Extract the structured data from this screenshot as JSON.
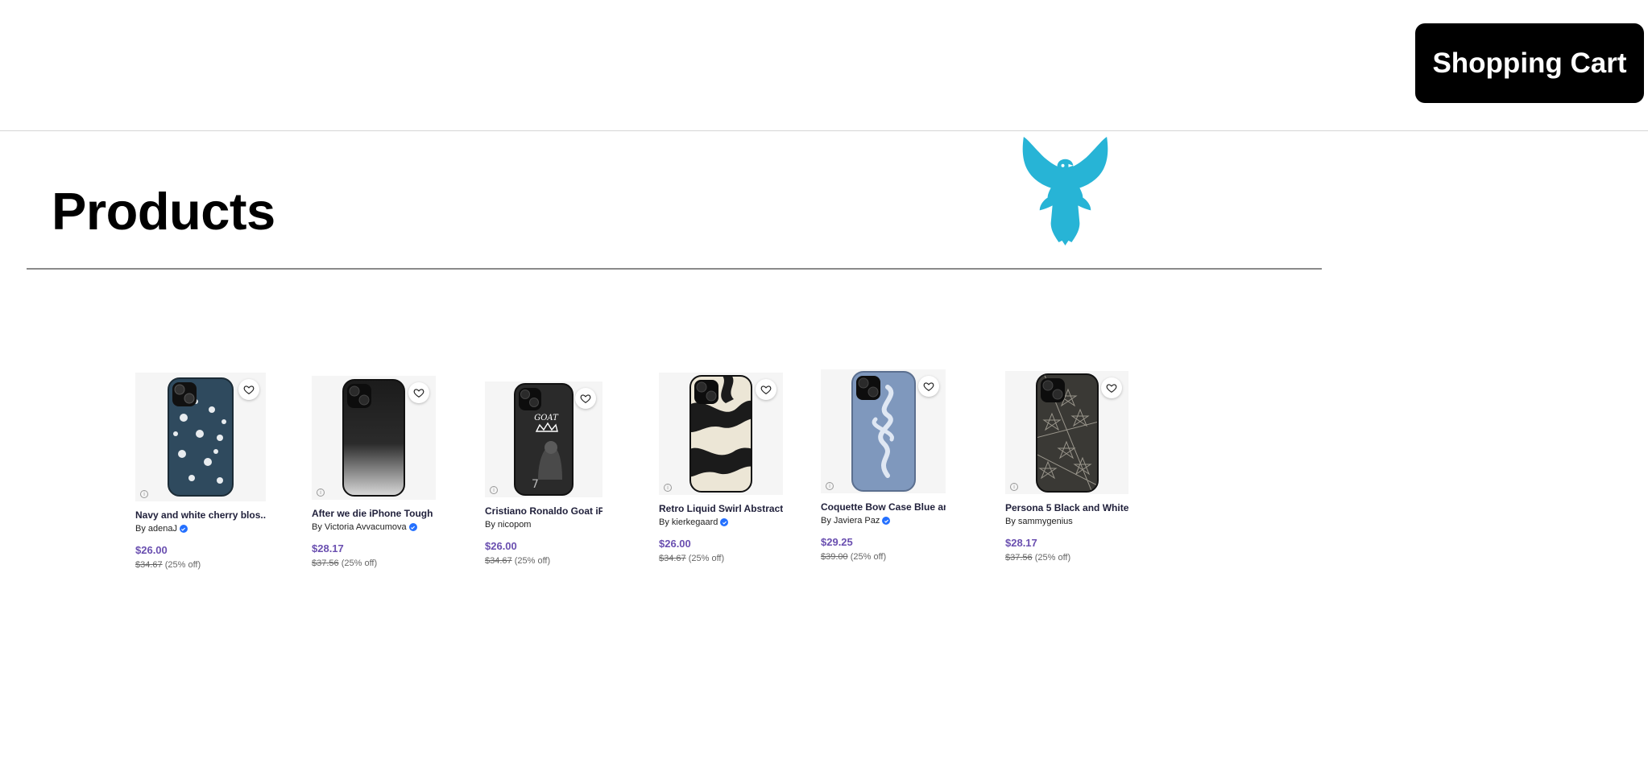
{
  "header": {
    "cart_label": "Shopping Cart"
  },
  "page": {
    "title": "Products",
    "logo_icon": "eagle-logo",
    "logo_color": "#27b4d6"
  },
  "products": [
    {
      "title": "Navy and white cherry blos...",
      "by": "By adenaJ",
      "verified": true,
      "price": "$26.00",
      "original": "$34.67",
      "discount": "(25% off)"
    },
    {
      "title": "After we die iPhone Tough ...",
      "by": "By Victoria Avvacumova",
      "verified": true,
      "price": "$28.17",
      "original": "$37.56",
      "discount": "(25% off)"
    },
    {
      "title": "Cristiano Ronaldo Goat iPho...",
      "by": "By nicopom",
      "verified": false,
      "price": "$26.00",
      "original": "$34.67",
      "discount": "(25% off)"
    },
    {
      "title": "Retro Liquid Swirl Abstract ...",
      "by": "By kierkegaard",
      "verified": true,
      "price": "$26.00",
      "original": "$34.67",
      "discount": "(25% off)"
    },
    {
      "title": "Coquette Bow Case Blue an...",
      "by": "By Javiera Paz",
      "verified": true,
      "price": "$29.25",
      "original": "$39.00",
      "discount": "(25% off)"
    },
    {
      "title": "Persona 5 Black and White ...",
      "by": "By sammygenius",
      "verified": false,
      "price": "$28.17",
      "original": "$37.56",
      "discount": "(25% off)"
    }
  ],
  "colors": {
    "price": "#6a4fb0",
    "verified_badge": "#2470ff",
    "cart_bg": "#000000"
  },
  "icons": {
    "favorite": "heart-icon",
    "info": "info-icon",
    "verified": "verified-badge-icon"
  }
}
